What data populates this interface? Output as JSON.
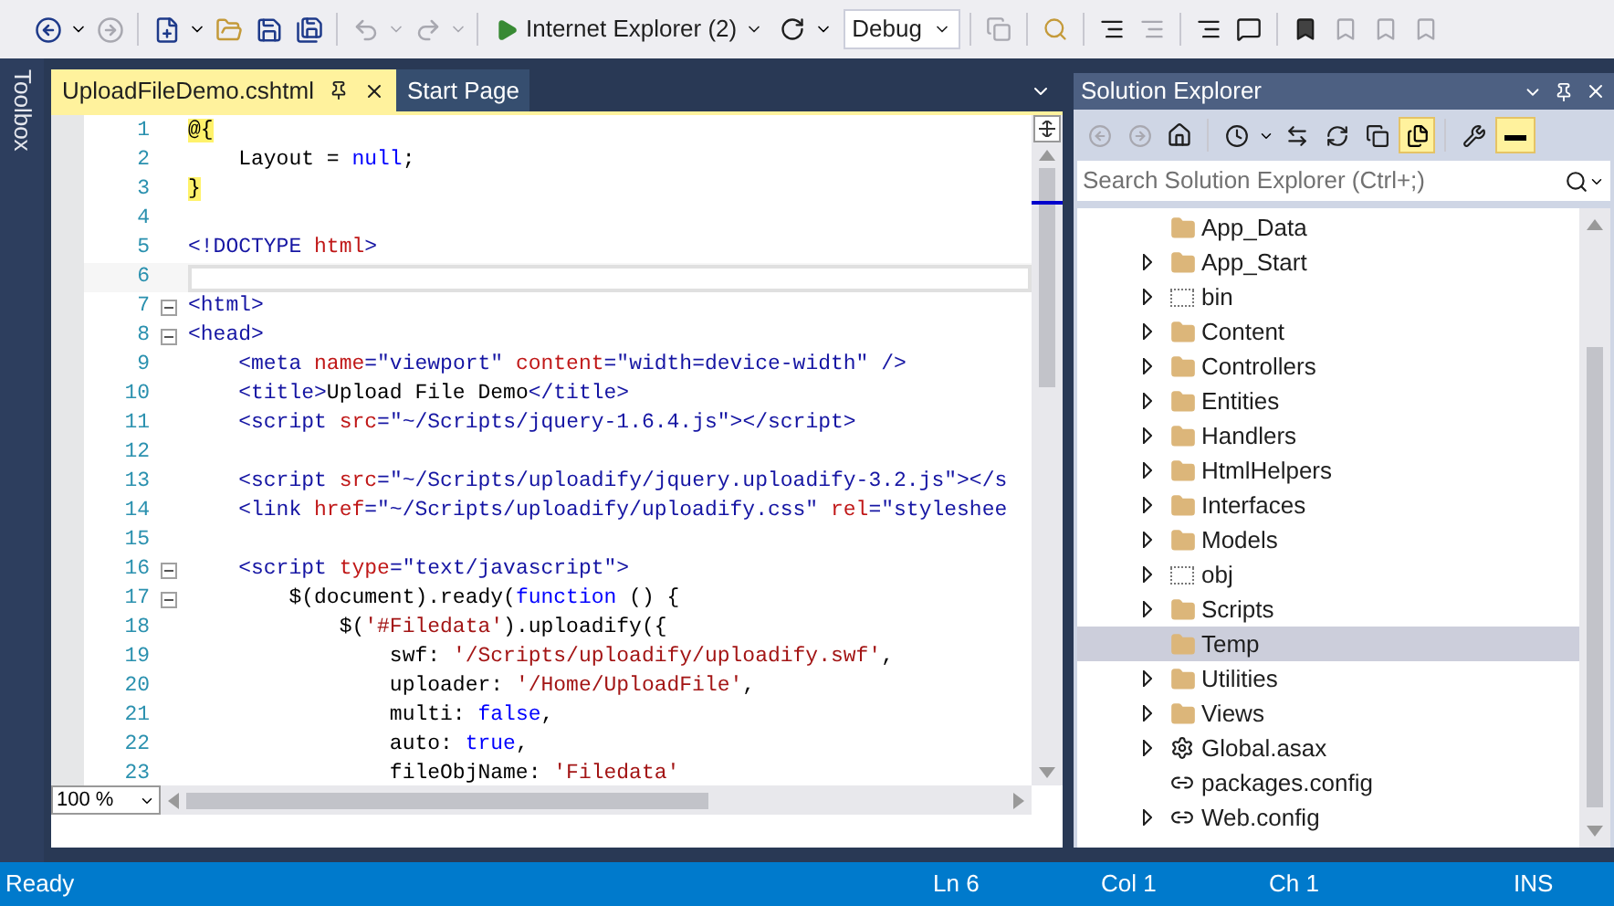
{
  "toolbar": {
    "run_target": "Internet Explorer (2)",
    "configuration": "Debug"
  },
  "toolbox": {
    "label": "Toolbox"
  },
  "editor": {
    "tabs": [
      {
        "label": "UploadFileDemo.cshtml",
        "selected": true
      },
      {
        "label": "Start Page",
        "selected": false
      }
    ],
    "lines": [
      {
        "number": "1",
        "fold": false,
        "current": false,
        "tokens": [
          {
            "kind": "razor",
            "text": "@{"
          }
        ]
      },
      {
        "number": "2",
        "fold": false,
        "current": false,
        "tokens": [
          {
            "kind": "plain",
            "text": "    Layout = "
          },
          {
            "kind": "keyword",
            "text": "null"
          },
          {
            "kind": "plain",
            "text": ";"
          }
        ]
      },
      {
        "number": "3",
        "fold": false,
        "current": false,
        "tokens": [
          {
            "kind": "razor",
            "text": "}"
          }
        ]
      },
      {
        "number": "4",
        "fold": false,
        "current": false
      },
      {
        "number": "5",
        "fold": false,
        "current": false,
        "tokens": [
          {
            "kind": "tag",
            "text": "<!DOCTYPE "
          },
          {
            "kind": "attr",
            "text": "html"
          },
          {
            "kind": "tag",
            "text": ">"
          }
        ]
      },
      {
        "number": "6",
        "fold": false,
        "current": true
      },
      {
        "number": "7",
        "fold": true,
        "current": false,
        "tokens": [
          {
            "kind": "tag",
            "text": "<html>"
          }
        ]
      },
      {
        "number": "8",
        "fold": true,
        "current": false,
        "tokens": [
          {
            "kind": "tag",
            "text": "<head>"
          }
        ]
      },
      {
        "number": "9",
        "fold": false,
        "current": false,
        "tokens": [
          {
            "kind": "tag",
            "text": "    <meta "
          },
          {
            "kind": "attr",
            "text": "name"
          },
          {
            "kind": "tag",
            "text": "="
          },
          {
            "kind": "string",
            "text": "\"viewport\" "
          },
          {
            "kind": "attr",
            "text": "content"
          },
          {
            "kind": "tag",
            "text": "="
          },
          {
            "kind": "string",
            "text": "\"width=device-width\""
          },
          {
            "kind": "tag",
            "text": " />"
          }
        ]
      },
      {
        "number": "10",
        "fold": false,
        "current": false,
        "tokens": [
          {
            "kind": "tag",
            "text": "    <title>"
          },
          {
            "kind": "plain",
            "text": "Upload File Demo"
          },
          {
            "kind": "tag",
            "text": "</title>"
          }
        ]
      },
      {
        "number": "11",
        "fold": false,
        "current": false,
        "tokens": [
          {
            "kind": "tag",
            "text": "    <script "
          },
          {
            "kind": "attr",
            "text": "src"
          },
          {
            "kind": "tag",
            "text": "="
          },
          {
            "kind": "string",
            "text": "\"~/Scripts/jquery-1.6.4.js\""
          },
          {
            "kind": "tag",
            "text": "></script>"
          }
        ]
      },
      {
        "number": "12",
        "fold": false,
        "current": false
      },
      {
        "number": "13",
        "fold": false,
        "current": false,
        "tokens": [
          {
            "kind": "tag",
            "text": "    <script "
          },
          {
            "kind": "attr",
            "text": "src"
          },
          {
            "kind": "tag",
            "text": "="
          },
          {
            "kind": "string",
            "text": "\"~/Scripts/uploadify/jquery.uploadify-3.2.js\""
          },
          {
            "kind": "tag",
            "text": "></s"
          }
        ]
      },
      {
        "number": "14",
        "fold": false,
        "current": false,
        "tokens": [
          {
            "kind": "tag",
            "text": "    <link "
          },
          {
            "kind": "attr",
            "text": "href"
          },
          {
            "kind": "tag",
            "text": "="
          },
          {
            "kind": "string",
            "text": "\"~/Scripts/uploadify/uploadify.css\" "
          },
          {
            "kind": "attr",
            "text": "rel"
          },
          {
            "kind": "tag",
            "text": "="
          },
          {
            "kind": "string",
            "text": "\"styleshee"
          }
        ]
      },
      {
        "number": "15",
        "fold": false,
        "current": false
      },
      {
        "number": "16",
        "fold": true,
        "current": false,
        "tokens": [
          {
            "kind": "tag",
            "text": "    <script "
          },
          {
            "kind": "attr",
            "text": "type"
          },
          {
            "kind": "tag",
            "text": "="
          },
          {
            "kind": "string",
            "text": "\"text/javascript\""
          },
          {
            "kind": "tag",
            "text": ">"
          }
        ]
      },
      {
        "number": "17",
        "fold": true,
        "current": false,
        "tokens": [
          {
            "kind": "plain",
            "text": "        $(document).ready("
          },
          {
            "kind": "keyword",
            "text": "function"
          },
          {
            "kind": "plain",
            "text": " () {"
          }
        ]
      },
      {
        "number": "18",
        "fold": false,
        "current": false,
        "tokens": [
          {
            "kind": "plain",
            "text": "            $("
          },
          {
            "kind": "jsstring",
            "text": "'#Filedata'"
          },
          {
            "kind": "plain",
            "text": ").uploadify({"
          }
        ]
      },
      {
        "number": "19",
        "fold": false,
        "current": false,
        "tokens": [
          {
            "kind": "plain",
            "text": "                swf: "
          },
          {
            "kind": "jsstring",
            "text": "'/Scripts/uploadify/uploadify.swf'"
          },
          {
            "kind": "plain",
            "text": ","
          }
        ]
      },
      {
        "number": "20",
        "fold": false,
        "current": false,
        "tokens": [
          {
            "kind": "plain",
            "text": "                uploader: "
          },
          {
            "kind": "jsstring",
            "text": "'/Home/UploadFile'"
          },
          {
            "kind": "plain",
            "text": ","
          }
        ]
      },
      {
        "number": "21",
        "fold": false,
        "current": false,
        "tokens": [
          {
            "kind": "plain",
            "text": "                multi: "
          },
          {
            "kind": "keyword",
            "text": "false"
          },
          {
            "kind": "plain",
            "text": ","
          }
        ]
      },
      {
        "number": "22",
        "fold": false,
        "current": false,
        "tokens": [
          {
            "kind": "plain",
            "text": "                auto: "
          },
          {
            "kind": "keyword",
            "text": "true"
          },
          {
            "kind": "plain",
            "text": ","
          }
        ]
      },
      {
        "number": "23",
        "fold": false,
        "current": false,
        "tokens": [
          {
            "kind": "plain",
            "text": "                fileObjName: "
          },
          {
            "kind": "jsstring",
            "text": "'Filedata'"
          }
        ]
      }
    ],
    "zoom": "100 %"
  },
  "solution_explorer": {
    "title": "Solution Explorer",
    "search": {
      "placeholder": "Search Solution Explorer (Ctrl+;)"
    },
    "items": [
      {
        "label": "App_Data",
        "kind": "folder",
        "expandable": false,
        "selected": false
      },
      {
        "label": "App_Start",
        "kind": "folder",
        "expandable": true,
        "selected": false
      },
      {
        "label": "bin",
        "kind": "hidden-folder",
        "expandable": true,
        "selected": false
      },
      {
        "label": "Content",
        "kind": "folder",
        "expandable": true,
        "selected": false
      },
      {
        "label": "Controllers",
        "kind": "folder",
        "expandable": true,
        "selected": false
      },
      {
        "label": "Entities",
        "kind": "folder",
        "expandable": true,
        "selected": false
      },
      {
        "label": "Handlers",
        "kind": "folder",
        "expandable": true,
        "selected": false
      },
      {
        "label": "HtmlHelpers",
        "kind": "folder",
        "expandable": true,
        "selected": false
      },
      {
        "label": "Interfaces",
        "kind": "folder",
        "expandable": true,
        "selected": false
      },
      {
        "label": "Models",
        "kind": "folder",
        "expandable": true,
        "selected": false
      },
      {
        "label": "obj",
        "kind": "hidden-folder",
        "expandable": true,
        "selected": false
      },
      {
        "label": "Scripts",
        "kind": "folder",
        "expandable": true,
        "selected": false
      },
      {
        "label": "Temp",
        "kind": "folder",
        "expandable": false,
        "selected": true
      },
      {
        "label": "Utilities",
        "kind": "folder",
        "expandable": true,
        "selected": false
      },
      {
        "label": "Views",
        "kind": "folder",
        "expandable": true,
        "selected": false
      },
      {
        "label": "Global.asax",
        "kind": "code-file",
        "expandable": true,
        "selected": false
      },
      {
        "label": "packages.config",
        "kind": "config-file",
        "expandable": false,
        "selected": false
      },
      {
        "label": "Web.config",
        "kind": "config-file",
        "expandable": true,
        "selected": false
      }
    ]
  },
  "status_bar": {
    "message": "Ready",
    "line": "Ln 6",
    "column": "Col 1",
    "char": "Ch 1",
    "mode": "INS"
  }
}
